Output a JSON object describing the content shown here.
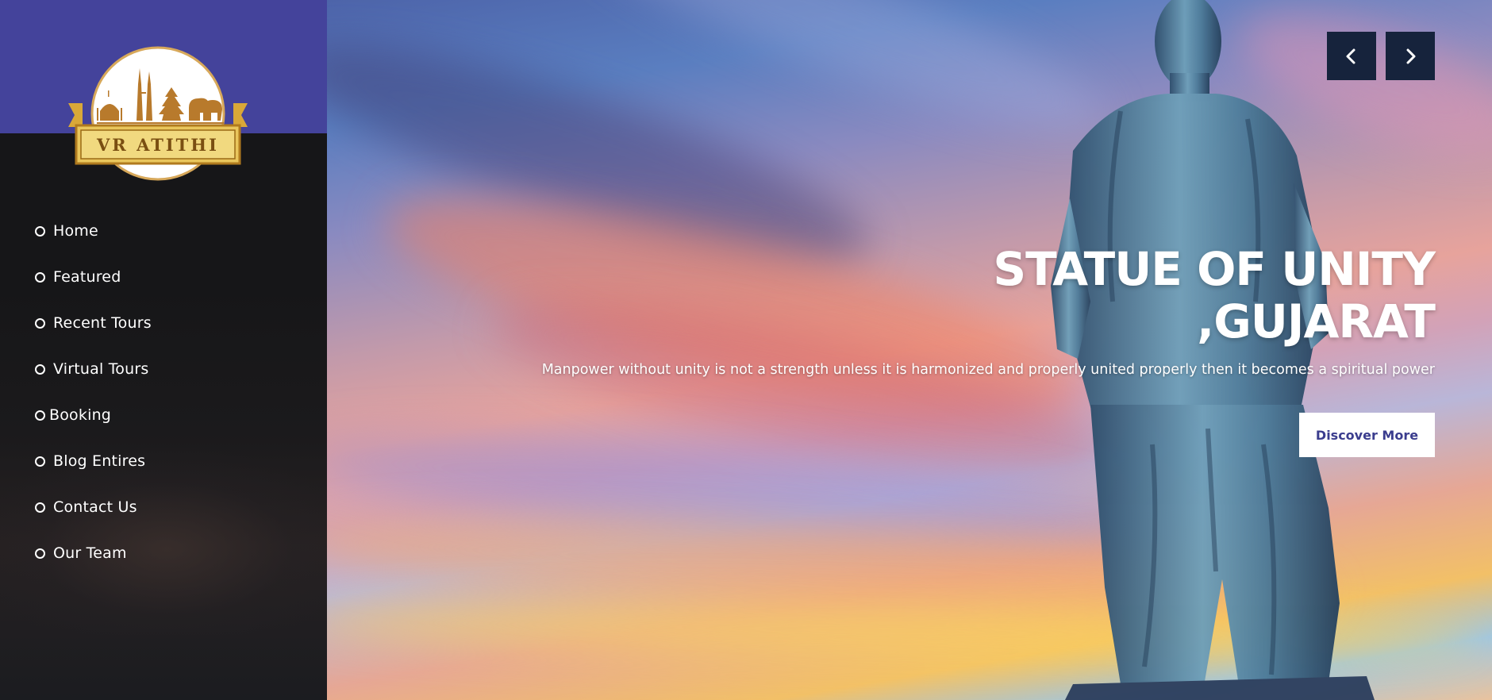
{
  "brand": {
    "name": "VR ATITHI",
    "colors": {
      "sidebar_header": "#44439b",
      "sidebar": "#161617",
      "cta_text": "#3b3d8e",
      "arrow_bg": "#16233c"
    }
  },
  "nav": {
    "items": [
      {
        "label": "Home"
      },
      {
        "label": "Featured"
      },
      {
        "label": "Recent Tours"
      },
      {
        "label": "Virtual Tours"
      },
      {
        "label": "Booking"
      },
      {
        "label": "Blog Entires"
      },
      {
        "label": "Contact Us"
      },
      {
        "label": "Our Team"
      }
    ],
    "bullet_icon": "circle-outline-icon"
  },
  "slider": {
    "prev_icon": "chevron-left-icon",
    "next_icon": "chevron-right-icon",
    "title_line1": "STATUE OF UNITY",
    "title_line2": ",GUJARAT",
    "subtitle": "Manpower without unity is not a strength unless it is harmonized and properly united properly then it becomes a spiritual power",
    "cta_label": "Discover More"
  }
}
